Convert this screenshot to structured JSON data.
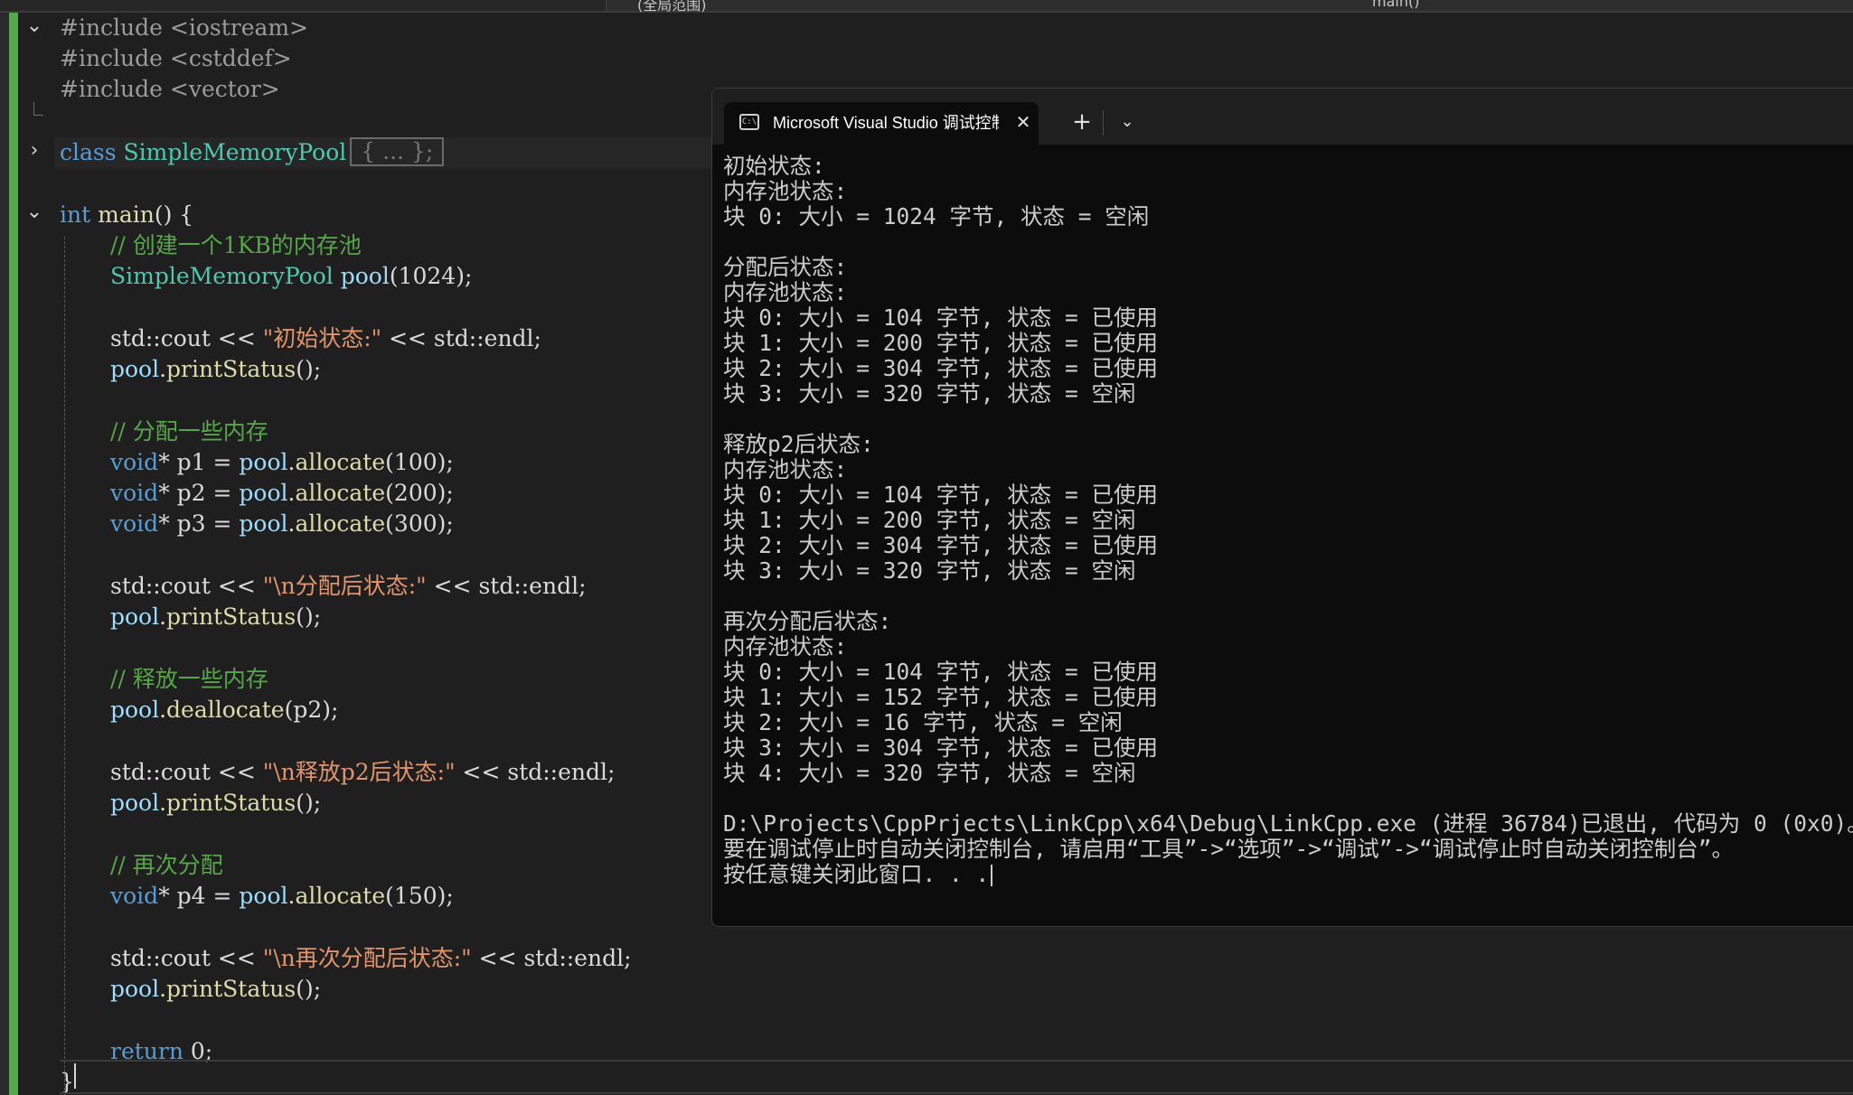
{
  "top_nav": {
    "scope_label": "(全局范围)",
    "member_label": "main()"
  },
  "editor": {
    "lines": {
      "l1": "#include <iostream>",
      "l2": "#include <cstddef>",
      "l3": "#include <vector>",
      "l5_kw": "class",
      "l5_name": "SimpleMemoryPool",
      "l5_collapsed": "{ ... };",
      "l7_kw": "int",
      "l7_fn": "main",
      "l7_rest": "() {",
      "l8": "// 创建一个1KB的内存池",
      "l9_type": "SimpleMemoryPool",
      "l9_var": "pool",
      "l9_rest": "(1024);",
      "l11_a": "std::cout << ",
      "l11_str": "\"初始状态:\"",
      "l11_b": " << std::endl;",
      "l12_var": "pool",
      "l12_fn": ".printStatus",
      "l12_rest": "();",
      "l14": "// 分配一些内存",
      "l15_kw": "void",
      "l15_rest": "* p1 = ",
      "l15_var": "pool",
      "l15_fn": ".allocate",
      "l15_args": "(100);",
      "l16_kw": "void",
      "l16_rest": "* p2 = ",
      "l16_var": "pool",
      "l16_fn": ".allocate",
      "l16_args": "(200);",
      "l17_kw": "void",
      "l17_rest": "* p3 = ",
      "l17_var": "pool",
      "l17_fn": ".allocate",
      "l17_args": "(300);",
      "l19_a": "std::cout << ",
      "l19_str": "\"\\n分配后状态:\"",
      "l19_b": " << std::endl;",
      "l20_var": "pool",
      "l20_fn": ".printStatus",
      "l20_rest": "();",
      "l22": "// 释放一些内存",
      "l23_var": "pool",
      "l23_fn": ".deallocate",
      "l23_rest": "(p2);",
      "l25_a": "std::cout << ",
      "l25_str": "\"\\n释放p2后状态:\"",
      "l25_b": " << std::endl;",
      "l26_var": "pool",
      "l26_fn": ".printStatus",
      "l26_rest": "();",
      "l28": "// 再次分配",
      "l29_kw": "void",
      "l29_rest": "* p4 = ",
      "l29_var": "pool",
      "l29_fn": ".allocate",
      "l29_args": "(150);",
      "l31_a": "std::cout << ",
      "l31_str": "\"\\n再次分配后状态:\"",
      "l31_b": " << std::endl;",
      "l32_var": "pool",
      "l32_fn": ".printStatus",
      "l32_rest": "();",
      "l34_kw": "return",
      "l34_rest": " 0;",
      "l35": "}"
    }
  },
  "console": {
    "tab_title": "Microsoft Visual Studio 调试控制台",
    "icon_text": "C:\\",
    "output_lines": [
      "初始状态:",
      "内存池状态:",
      "块 0: 大小 = 1024 字节, 状态 = 空闲",
      "",
      "分配后状态:",
      "内存池状态:",
      "块 0: 大小 = 104 字节, 状态 = 已使用",
      "块 1: 大小 = 200 字节, 状态 = 已使用",
      "块 2: 大小 = 304 字节, 状态 = 已使用",
      "块 3: 大小 = 320 字节, 状态 = 空闲",
      "",
      "释放p2后状态:",
      "内存池状态:",
      "块 0: 大小 = 104 字节, 状态 = 已使用",
      "块 1: 大小 = 200 字节, 状态 = 空闲",
      "块 2: 大小 = 304 字节, 状态 = 已使用",
      "块 3: 大小 = 320 字节, 状态 = 空闲",
      "",
      "再次分配后状态:",
      "内存池状态:",
      "块 0: 大小 = 104 字节, 状态 = 已使用",
      "块 1: 大小 = 152 字节, 状态 = 已使用",
      "块 2: 大小 = 16 字节, 状态 = 空闲",
      "块 3: 大小 = 304 字节, 状态 = 已使用",
      "块 4: 大小 = 320 字节, 状态 = 空闲",
      "",
      "D:\\Projects\\CppPrjects\\LinkCpp\\x64\\Debug\\LinkCpp.exe (进程 36784)已退出, 代码为 0 (0x0)。",
      "要在调试停止时自动关闭控制台, 请启用“工具”->“选项”->“调试”->“调试停止时自动关闭控制台”。",
      "按任意键关闭此窗口. . ."
    ]
  },
  "icons": {
    "fold_open": "chevron-down-icon",
    "fold_closed": "chevron-right-icon",
    "tab_close": "close-icon",
    "new_tab": "plus-icon",
    "tab_dropdown": "chevron-down-icon",
    "console_app": "terminal-icon"
  },
  "colors": {
    "editor_bg": "#1f1f1f",
    "console_bg": "#0c0c0c",
    "change_bar": "#54a74c",
    "keyword": "#569cd6",
    "type": "#4ec9b0",
    "function": "#dcdcaa",
    "variable": "#9cdcfe",
    "string": "#e2946b",
    "comment": "#57a64a"
  }
}
